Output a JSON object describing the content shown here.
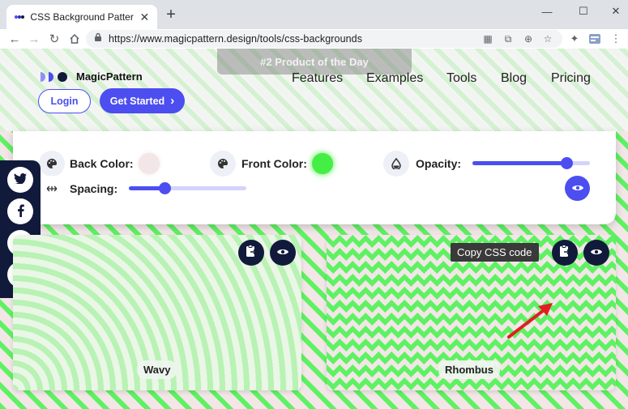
{
  "browser": {
    "tab_title": "CSS Background Patterns by M",
    "new_tab": "+",
    "url": "https://www.magicpattern.design/tools/css-backgrounds",
    "window_controls": [
      "—",
      "☐",
      "✕"
    ]
  },
  "header": {
    "product_badge": "#2 Product of the Day",
    "logo_text": "MagicPattern",
    "nav": [
      "Features",
      "Examples",
      "Tools",
      "Blog",
      "Pricing"
    ],
    "login_label": "Login",
    "start_label": "Get Started",
    "start_chevron": "›"
  },
  "controls": {
    "back_color_label": "Back Color:",
    "back_color": "#f2e6e7",
    "front_color_label": "Front Color:",
    "front_color": "#45ee45",
    "opacity_label": "Opacity:",
    "opacity_value": 0.8,
    "spacing_label": "Spacing:",
    "spacing_value": 0.3
  },
  "social": [
    "twitter",
    "facebook",
    "linkedin",
    "telegram"
  ],
  "cards": [
    {
      "label": "Wavy"
    },
    {
      "label": "Rhombus"
    }
  ],
  "tooltip": "Copy CSS code",
  "colors": {
    "accent": "#4c4ef0",
    "dark": "#111a3a",
    "green": "#5ef262",
    "pink": "#f2e6e7"
  }
}
